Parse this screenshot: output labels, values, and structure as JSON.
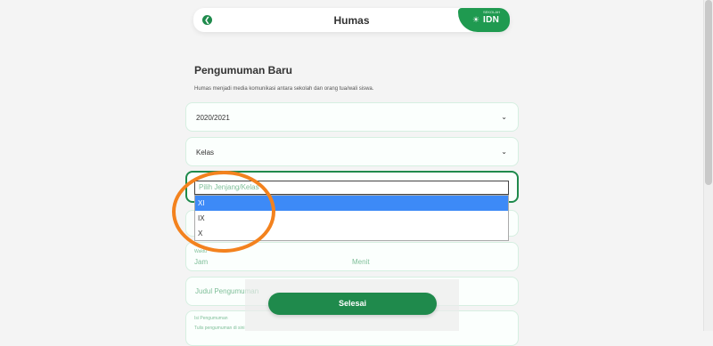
{
  "header": {
    "title": "Humas",
    "brand_tag": "SEKOLAH",
    "brand_name": "IDN"
  },
  "section": {
    "title": "Pengumuman Baru",
    "description": "Humas menjadi media komunikasi antara sekolah dan orang tua/wali siswa."
  },
  "form": {
    "tahun_ajaran": "2020/2021",
    "kelas": "Kelas",
    "jenjang_placeholder": "Pilih Jenjang/Kelas",
    "jenjang_options": [
      "XI",
      "IX",
      "X"
    ],
    "jenjang_selected": "XI",
    "waktu_label": "Waktu",
    "jam_placeholder": "Jam",
    "menit_placeholder": "Menit",
    "judul_placeholder": "Judul Pengumuman",
    "isi_label": "Isi Pengumuman",
    "isi_placeholder": "Tulis pengumuman di sini"
  },
  "actions": {
    "submit_label": "Selesai"
  },
  "colors": {
    "primary": "#1f8a4c",
    "accent_highlight": "#f3821e",
    "selection": "#3d8af7",
    "placeholder": "#7fbf99"
  },
  "icons": {
    "back": "back-arrow-icon",
    "chevron": "chevron-down-icon",
    "brand": "sun-icon"
  }
}
